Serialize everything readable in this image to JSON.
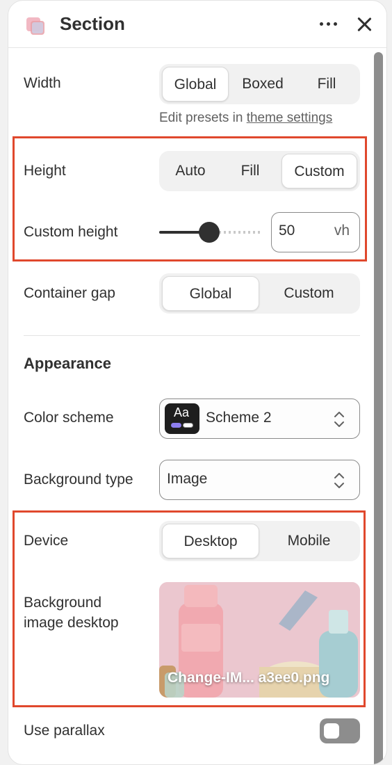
{
  "header": {
    "title": "Section",
    "icon": "section-icon",
    "more_icon": "more-horizontal-icon",
    "close_icon": "close-icon"
  },
  "width": {
    "label": "Width",
    "options": [
      "Global",
      "Boxed",
      "Fill"
    ],
    "selected": "Global",
    "hint_prefix": "Edit presets in",
    "hint_link": "theme settings"
  },
  "height": {
    "label": "Height",
    "options": [
      "Auto",
      "Fill",
      "Custom"
    ],
    "selected": "Custom"
  },
  "custom_height": {
    "label": "Custom height",
    "value": "50",
    "unit": "vh",
    "slider_fraction": 0.45
  },
  "container_gap": {
    "label": "Container gap",
    "options": [
      "Global",
      "Custom"
    ],
    "selected": "Global"
  },
  "appearance": {
    "heading": "Appearance",
    "color_scheme": {
      "label": "Color scheme",
      "swatch_text": "Aa",
      "value": "Scheme 2"
    },
    "background_type": {
      "label": "Background type",
      "value": "Image"
    },
    "device": {
      "label": "Device",
      "options": [
        "Desktop",
        "Mobile"
      ],
      "selected": "Desktop"
    },
    "background_image": {
      "label_line1": "Background",
      "label_line2": "image desktop",
      "filename": "Change-IM...  a3ee0.png"
    },
    "parallax": {
      "label": "Use parallax",
      "enabled": false
    }
  },
  "colors": {
    "highlight": "#e0482d",
    "scheme_swatch_bg": "#1e1e1e",
    "scheme_accent": "#8e7ff0"
  }
}
